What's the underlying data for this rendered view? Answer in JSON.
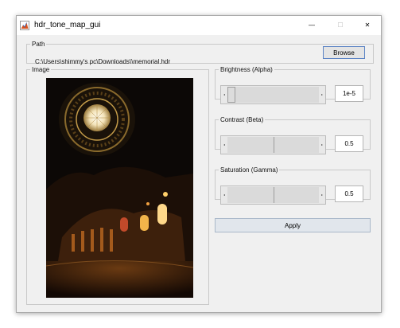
{
  "window": {
    "title": "hdr_tone_map_gui",
    "minimize_label": "—",
    "maximize_label": "☐",
    "close_label": "✕"
  },
  "path_panel": {
    "label": "Path",
    "value": "C:\\Users\\shimmy's pc\\Downloads\\\\memorial.hdr",
    "browse_label": "Browse"
  },
  "image_panel": {
    "label": "Image"
  },
  "controls": [
    {
      "label": "Brightness (Alpha)",
      "value": "1e-5",
      "position": 0.0
    },
    {
      "label": "Contrast (Beta)",
      "value": "0.5",
      "position": 0.5
    },
    {
      "label": "Saturation (Gamma)",
      "value": "0.5",
      "position": 0.5
    }
  ],
  "apply_label": "Apply",
  "icons": {
    "app": "matlab-figure-icon",
    "slider_left": "arrow-left-icon",
    "slider_right": "arrow-right-icon"
  }
}
